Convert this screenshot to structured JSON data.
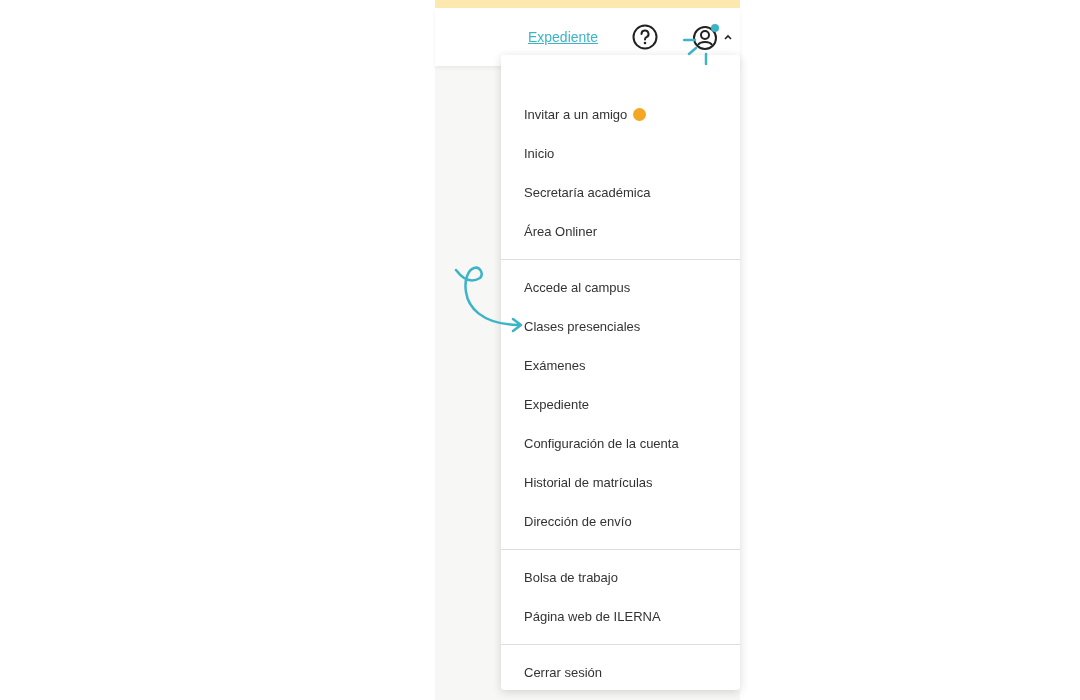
{
  "header": {
    "link": "Expediente",
    "menu_open": true,
    "notification": true
  },
  "menu": {
    "groups": [
      {
        "items": [
          {
            "label": "Invitar a un amigo",
            "kind": "emoji"
          },
          {
            "label": "Inicio",
            "kind": "plain"
          },
          {
            "label": "Secretaría académica",
            "kind": "plain"
          },
          {
            "label": "Área Onliner",
            "kind": "plain"
          }
        ]
      },
      {
        "items": [
          {
            "label": "Accede al campus",
            "kind": "plain"
          },
          {
            "label": "Clases presenciales",
            "kind": "plain"
          },
          {
            "label": "Exámenes",
            "kind": "plain"
          },
          {
            "label": "Expediente",
            "kind": "plain"
          },
          {
            "label": "Configuración de la cuenta",
            "kind": "plain"
          },
          {
            "label": "Historial de matrículas",
            "kind": "plain"
          },
          {
            "label": "Dirección de envío",
            "kind": "plain"
          }
        ]
      },
      {
        "items": [
          {
            "label": "Bolsa de trabajo",
            "kind": "plain"
          },
          {
            "label": "Página web de ILERNA",
            "kind": "plain"
          }
        ]
      },
      {
        "items": [
          {
            "label": "Cerrar sesión",
            "kind": "plain"
          }
        ]
      }
    ]
  }
}
